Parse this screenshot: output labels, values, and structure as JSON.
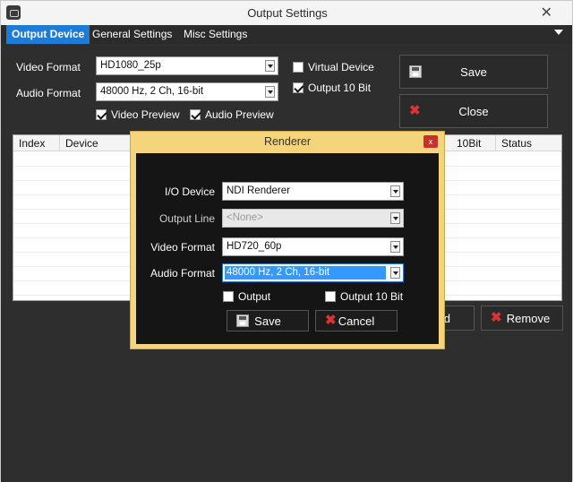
{
  "window": {
    "title": "Output Settings"
  },
  "tabs": [
    {
      "label": "Output Device",
      "active": true
    },
    {
      "label": "General Settings",
      "active": false
    },
    {
      "label": "Misc Settings",
      "active": false
    }
  ],
  "main": {
    "video_format_label": "Video Format",
    "video_format_value": "HD1080_25p",
    "audio_format_label": "Audio Format",
    "audio_format_value": "48000 Hz, 2 Ch, 16-bit",
    "virtual_device": {
      "label": "Virtual Device",
      "checked": false
    },
    "output_10bit": {
      "label": "Output 10 Bit",
      "checked": true
    },
    "video_preview": {
      "label": "Video Preview",
      "checked": true
    },
    "audio_preview": {
      "label": "Audio Preview",
      "checked": true
    },
    "save_label": "Save",
    "close_label": "Close",
    "add_label_partial": "d",
    "remove_label": "Remove"
  },
  "table": {
    "columns": [
      "Index",
      "Device",
      "10Bit",
      "Status"
    ]
  },
  "dialog": {
    "title": "Renderer",
    "close_glyph": "x",
    "io_device_label": "I/O Device",
    "io_device_value": "NDI Renderer",
    "output_line_label": "Output Line",
    "output_line_value": "<None>",
    "video_format_label": "Video Format",
    "video_format_value": "HD720_60p",
    "audio_format_label": "Audio Format",
    "audio_format_value": "48000 Hz, 2 Ch, 16-bit",
    "output": {
      "label": "Output",
      "checked": false
    },
    "output_10bit": {
      "label": "Output 10 Bit",
      "checked": false
    },
    "save_label": "Save",
    "cancel_label": "Cancel"
  },
  "colors": {
    "tab_active": "#1e7bd6",
    "panel_bg": "#2e2e2e",
    "dialog_frame": "#f4d57c",
    "cancel_icon": "#e03030"
  }
}
